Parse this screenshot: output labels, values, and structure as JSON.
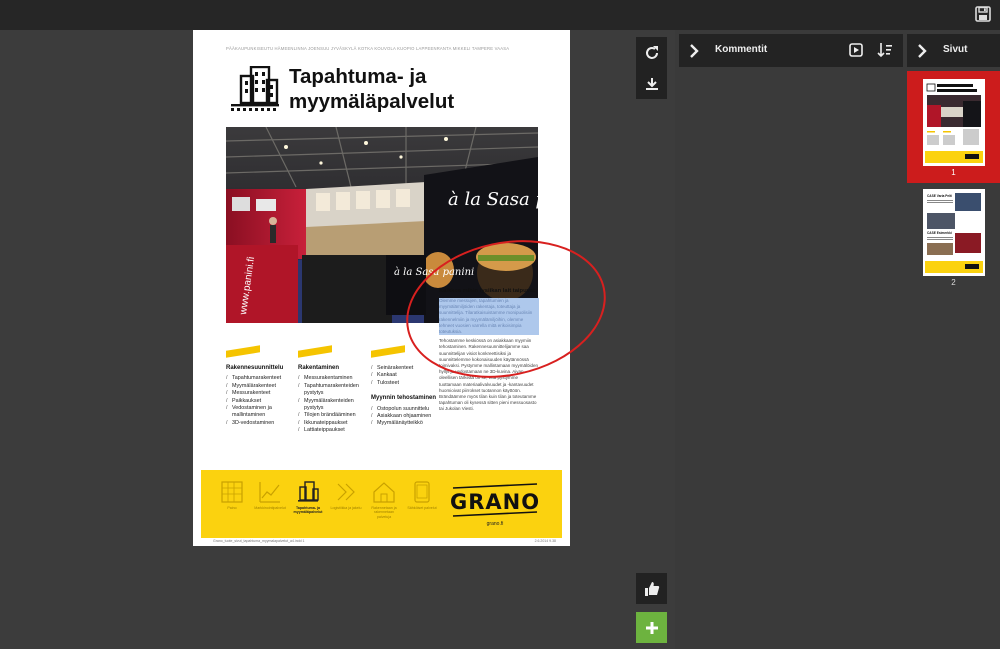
{
  "toolbar": {
    "save_icon": "save-icon"
  },
  "document": {
    "cities": "PÄÄKAUPUNKISEUTU  HÄMEENLINNA  JOENSUU  JYVÄSKYLÄ  KOTKA  KOUVOLA  KUOPIO  LAPPEENRANTA  MIKKELI  TAMPERE  VAASA",
    "title": "Tapahtuma- ja myymäläpalvelut",
    "photo_signs": [
      "à la Sasa panini",
      "à la Sasa panini",
      "www.panini.fi"
    ],
    "callout_heading": "Kaikkea mihin fysiikan lait taipuvat.",
    "callout_highlight": "Olemme messujen, tapahtumien ja myymälämiljöiden rakentaja, toteuttaja ja suunnittelija. Tilaratkaisuistamme monipuolisiin rakennelmiin ja myymälämiljöihin, olemme tehneet vuosien varrella mitä erikoisimpia toteutuksia.",
    "callout_body": "Tehostamme keskiössä on asiakkaan myymiin tehostaminen. Rakennesuunnittelijamme saa suunnittelijan visiot konkreettisiksi ja suunnittelemme kokonaisuuden käytännössä toimivaksi. Pystymme mallintamaan myymälöiden hyllyt ja vedostamaan ne 3D-kuvina. Aivan oleellisen tärkeää on se, että pystymme tuottamaan materiaalivalvuudet ja -kantavuudet huomioivat piirrokset tuotannon käyttöön. Brändäämme myös tilan kuin tilan ja toteutamme tapahtuman oli kysessä sitten pieni messuosasto tai Jukolan Viesti.",
    "columns": [
      {
        "heading": "Rakennesuunnittelu",
        "items": [
          "Tapahtumarakenteet",
          "Myymälärakenteet",
          "Messurakenteet",
          "Paikkaukset",
          "Vedostaminen ja mallintaminen",
          "3D-vedostaminen"
        ]
      },
      {
        "heading": "Rakentaminen",
        "items": [
          "Messurakentaminen",
          "Tapahtumarakenteiden pystytys",
          "Myymälärakenteiden pystytys",
          "Tilojen brändääminen",
          "Ikkunateippaukset",
          "Lattiateippaukset"
        ]
      },
      {
        "heading": "",
        "items": [
          "Seinärakenteet",
          "Kankaat",
          "Tulosteet"
        ]
      },
      {
        "heading": "Myynnin tehostaminen",
        "items": [
          "Ostopolun suunnittelu",
          "Asiakkaan ohjaaminen",
          "Myymälänäytteikkö"
        ]
      }
    ],
    "services": [
      {
        "label": "Paino",
        "icon": "printing-icon"
      },
      {
        "label": "Markkinointipalvelut",
        "icon": "chart-icon"
      },
      {
        "label": "Tapahtuma- ja myymäläpalvelut",
        "icon": "building-icon"
      },
      {
        "label": "Logistiikka ja jakelu",
        "icon": "arrows-icon"
      },
      {
        "label": "Rakennetaan ja rakennetaan palveluja",
        "icon": "house-icon"
      },
      {
        "label": "Sähköiset palvelut",
        "icon": "tablet-icon"
      }
    ],
    "brand": "GRANO",
    "brand_url": "grano.fi",
    "footer_left": "Grano_tuote_sivut_tapahtuma_myymalapalvelut_a4.indd  1",
    "footer_right": "2.6.2014  9.38"
  },
  "tools": {
    "rotate": "rotate-icon",
    "download": "download-icon",
    "like": "thumbs-up-icon",
    "add": "plus-icon"
  },
  "comments": {
    "title": "Kommentit"
  },
  "pages": {
    "title": "Sivut",
    "thumbs": [
      {
        "number": "1",
        "selected": true
      },
      {
        "number": "2",
        "selected": false
      }
    ],
    "thumb2_headings": [
      "CASE Varia Pelti",
      "CASE Esimerkki"
    ]
  },
  "colors": {
    "accent_red": "#cc1c1c",
    "add_green": "#6db33f",
    "brand_yellow": "#fbd20f"
  }
}
